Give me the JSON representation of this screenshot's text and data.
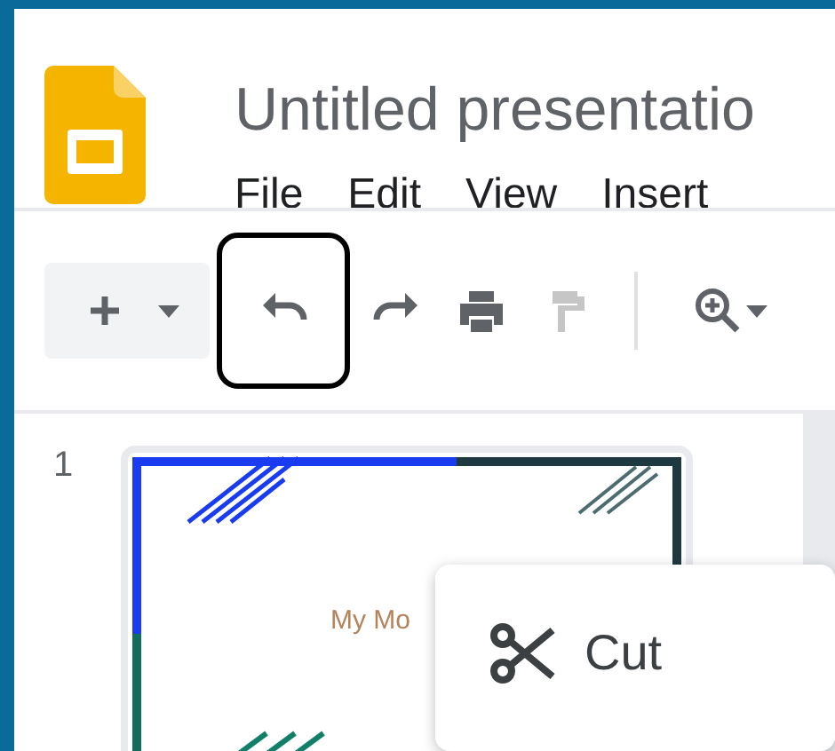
{
  "document": {
    "title": "Untitled presentatio"
  },
  "menu": [
    {
      "label": "File"
    },
    {
      "label": "Edit"
    },
    {
      "label": "View"
    },
    {
      "label": "Insert"
    }
  ],
  "toolbar": [
    {
      "kind": "new-slide",
      "disabled": false,
      "highlighted": false
    },
    {
      "kind": "undo",
      "disabled": false,
      "highlighted": true
    },
    {
      "kind": "redo",
      "disabled": false,
      "highlighted": false
    },
    {
      "kind": "print",
      "disabled": false,
      "highlighted": false
    },
    {
      "kind": "paint-format",
      "disabled": true,
      "highlighted": false
    },
    {
      "kind": "zoom",
      "disabled": false,
      "highlighted": false
    }
  ],
  "slides": [
    {
      "number": "1",
      "title": "My Mo"
    }
  ],
  "context_menu": {
    "items": [
      {
        "kind": "cut",
        "label": "Cut"
      }
    ]
  }
}
